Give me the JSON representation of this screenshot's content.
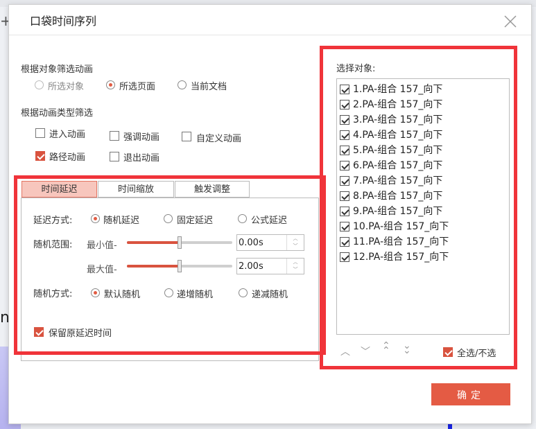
{
  "dialog": {
    "title": "口袋时间序列",
    "close_symbol": "×"
  },
  "filter_by_object": {
    "heading": "根据对象筛选动画",
    "options": [
      {
        "label": "所选对象",
        "selected": false,
        "disabled": true
      },
      {
        "label": "所选页面",
        "selected": true,
        "disabled": false
      },
      {
        "label": "当前文档",
        "selected": false,
        "disabled": false
      }
    ]
  },
  "filter_by_type": {
    "heading": "根据动画类型筛选",
    "options": [
      {
        "label": "进入动画",
        "checked": false
      },
      {
        "label": "强调动画",
        "checked": false
      },
      {
        "label": "自定义动画",
        "checked": false
      },
      {
        "label": "路径动画",
        "checked": true
      },
      {
        "label": "退出动画",
        "checked": false
      }
    ]
  },
  "tabs": [
    {
      "label": "时间延迟",
      "active": true
    },
    {
      "label": "时间缩放",
      "active": false
    },
    {
      "label": "触发调整",
      "active": false
    }
  ],
  "delay": {
    "mode_label": "延迟方式:",
    "modes": [
      {
        "label": "随机延迟",
        "selected": true
      },
      {
        "label": "固定延迟",
        "selected": false
      },
      {
        "label": "公式延迟",
        "selected": false
      }
    ],
    "range_label": "随机范围:",
    "min_label": "最小值-",
    "min_value": "0.00s",
    "min_fraction": 0.5,
    "max_label": "最大值-",
    "max_value": "2.00s",
    "max_fraction": 0.5,
    "random_label": "随机方式:",
    "random_modes": [
      {
        "label": "默认随机",
        "selected": true
      },
      {
        "label": "递增随机",
        "selected": false
      },
      {
        "label": "递减随机",
        "selected": false
      }
    ],
    "keep_original_label": "保留原延迟时间",
    "keep_original_checked": true
  },
  "objects": {
    "heading": "选择对象:",
    "items": [
      {
        "label": "1.PA-组合 157_向下",
        "checked": true
      },
      {
        "label": "2.PA-组合 157_向下",
        "checked": true
      },
      {
        "label": "3.PA-组合 157_向下",
        "checked": true
      },
      {
        "label": "4.PA-组合 157_向下",
        "checked": true
      },
      {
        "label": "5.PA-组合 157_向下",
        "checked": true
      },
      {
        "label": "6.PA-组合 157_向下",
        "checked": true
      },
      {
        "label": "7.PA-组合 157_向下",
        "checked": true
      },
      {
        "label": "8.PA-组合 157_向下",
        "checked": true
      },
      {
        "label": "9.PA-组合 157_向下",
        "checked": true
      },
      {
        "label": "10.PA-组合 157_向下",
        "checked": true
      },
      {
        "label": "11.PA-组合 157_向下",
        "checked": true
      },
      {
        "label": "12.PA-组合 157_向下",
        "checked": true
      }
    ],
    "nav": {
      "up": "︿",
      "down": "﹀",
      "top": "⌃",
      "bottom": "⌄"
    },
    "select_all_label": "全选/不选",
    "select_all_checked": true
  },
  "ok_label": "确定",
  "accent_color": "#e45b44",
  "highlight_color": "#f0343a"
}
